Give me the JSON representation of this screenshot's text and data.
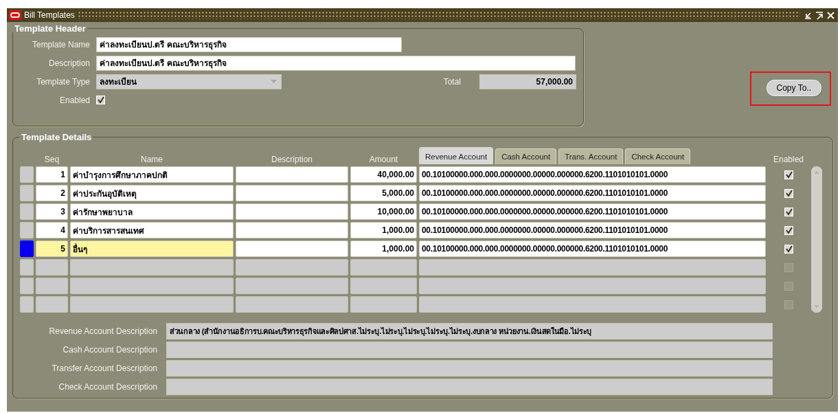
{
  "window": {
    "title": "Bill Templates"
  },
  "header": {
    "legend": "Template Header",
    "name": {
      "label": "Template Name",
      "value": "ค่าลงทะเบียนป.ตรี คณะบริหารธุรกิจ"
    },
    "description": {
      "label": "Description",
      "value": "ค่าลงทะเบียนป.ตรี คณะบริหารธุรกิจ"
    },
    "type": {
      "label": "Template Type",
      "value": "ลงทะเบียน"
    },
    "total": {
      "label": "Total",
      "value": "57,000.00"
    },
    "enabled": {
      "label": "Enabled",
      "checked": true
    }
  },
  "copy_button": {
    "label": "Copy To..",
    "highlighted": true
  },
  "details": {
    "legend": "Template Details",
    "columns": [
      "Seq",
      "Name",
      "Description",
      "Amount"
    ],
    "tabs": [
      {
        "label": "Revenue Account",
        "selected": true
      },
      {
        "label": "Cash Account",
        "selected": false
      },
      {
        "label": "Trans. Account",
        "selected": false
      },
      {
        "label": "Check Account",
        "selected": false
      }
    ],
    "enabled_header": "Enabled",
    "rows": [
      {
        "seq": "1",
        "name": "ค่าบำรุงการศึกษาภาคปกติ",
        "amount": "40,000.00",
        "account": "00.10100000.000.000.0000000.00000.000000.6200.1101010101.0000",
        "enabled": true,
        "selected": false
      },
      {
        "seq": "2",
        "name": "ค่าประกันอุบัติเหตุ",
        "amount": "5,000.00",
        "account": "00.10100000.000.000.0000000.00000.000000.6200.1101010101.0000",
        "enabled": true,
        "selected": false
      },
      {
        "seq": "3",
        "name": "ค่ารักษาพยาบาล",
        "amount": "10,000.00",
        "account": "00.10100000.000.000.0000000.00000.000000.6200.1101010101.0000",
        "enabled": true,
        "selected": false
      },
      {
        "seq": "4",
        "name": "ค่าบริการสารสนเทศ",
        "amount": "1,000.00",
        "account": "00.10100000.000.000.0000000.00000.000000.6200.1101010101.0000",
        "enabled": true,
        "selected": false
      },
      {
        "seq": "5",
        "name": "อื่นๆ",
        "amount": "1,000.00",
        "account": "00.10100000.000.000.0000000.00000.000000.6200.1101010101.0000",
        "enabled": true,
        "selected": true
      },
      {
        "enabled": false,
        "selected": false
      },
      {
        "enabled": false,
        "selected": false
      },
      {
        "enabled": false,
        "selected": false
      }
    ]
  },
  "account_descriptions": [
    {
      "label": "Revenue Account Description",
      "value": "ส่วนกลาง (สำนักงานอธิการบ.คณะบริหารธุรกิจและศิลปศาส.ไม่ระบุ.ไม่ระบุ.ไม่ระบุ.ไม่ระบุ.ไม่ระบุ.งบกลาง หน่วยงาน.เงินสดในมือ.ไม่ระบุ"
    },
    {
      "label": "Cash Account Description"
    },
    {
      "label": "Transfer Account Description"
    },
    {
      "label": "Check Account Description"
    }
  ]
}
